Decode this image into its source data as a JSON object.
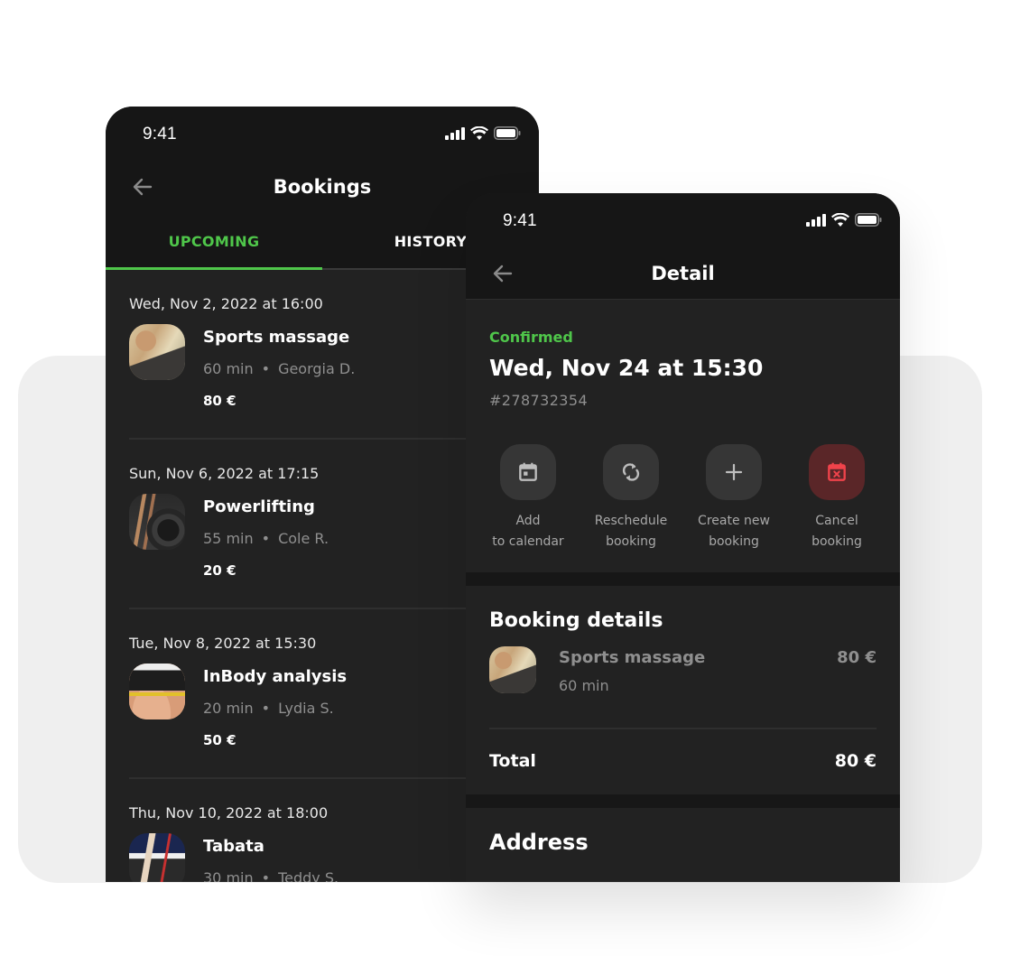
{
  "colors": {
    "accent": "#4fc64a",
    "danger": "#f0434b",
    "background": "#222222",
    "header": "#161616"
  },
  "bookings_screen": {
    "status_time": "9:41",
    "title": "Bookings",
    "back_icon": "arrow-left-icon",
    "tabs": [
      {
        "label": "UPCOMING",
        "active": true
      },
      {
        "label": "HISTORY",
        "active": false
      }
    ],
    "items": [
      {
        "date": "Wed, Nov 2, 2022 at 16:00",
        "name": "Sports massage",
        "duration": "60 min",
        "trainer": "Georgia D.",
        "price": "80 €",
        "image": "massage-photo"
      },
      {
        "date": "Sun, Nov 6, 2022 at 17:15",
        "name": "Powerlifting",
        "duration": "55 min",
        "trainer": "Cole R.",
        "price": "20 €",
        "image": "powerlifting-photo"
      },
      {
        "date": "Tue, Nov 8, 2022 at 15:30",
        "name": "InBody analysis",
        "duration": "20 min",
        "trainer": "Lydia S.",
        "price": "50 €",
        "image": "inbody-photo"
      },
      {
        "date": "Thu, Nov 10, 2022 at 18:00",
        "name": "Tabata",
        "duration": "30 min",
        "trainer": "Teddy S.",
        "price": "",
        "image": "tabata-photo"
      }
    ],
    "separator": "•"
  },
  "detail_screen": {
    "status_time": "9:41",
    "title": "Detail",
    "status": "Confirmed",
    "date": "Wed, Nov 24 at 15:30",
    "booking_id": "#278732354",
    "actions": [
      {
        "line1": "Add",
        "line2": "to calendar",
        "icon": "calendar-icon"
      },
      {
        "line1": "Reschedule",
        "line2": "booking",
        "icon": "refresh-icon"
      },
      {
        "line1": "Create new",
        "line2": "booking",
        "icon": "plus-icon"
      },
      {
        "line1": "Cancel",
        "line2": "booking",
        "icon": "calendar-cancel-icon"
      }
    ],
    "booking_details": {
      "heading": "Booking details",
      "item": {
        "name": "Sports massage",
        "duration": "60 min",
        "price": "80 €"
      },
      "total_label": "Total",
      "total_value": "80 €"
    },
    "address_heading": "Address"
  }
}
